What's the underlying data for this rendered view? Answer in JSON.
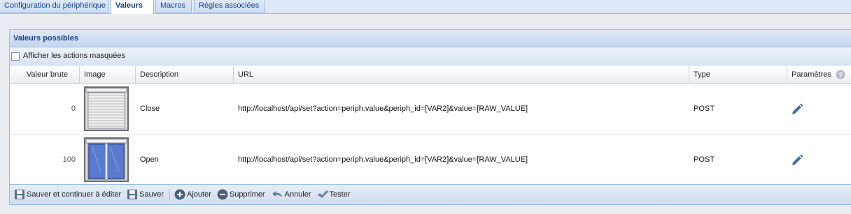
{
  "tabs": [
    {
      "label": "Configuration du périphérique"
    },
    {
      "label": "Valeurs"
    },
    {
      "label": "Macros"
    },
    {
      "label": "Règles associées"
    }
  ],
  "panel": {
    "title": "Valeurs possibles",
    "show_hidden_label": "Afficher les actions masquées"
  },
  "columns": {
    "raw": "Valeur brute",
    "image": "Image",
    "description": "Description",
    "url": "URL",
    "type": "Type",
    "params": "Paramètres"
  },
  "rows": [
    {
      "raw": "0",
      "image": "shutter-closed-icon",
      "description": "Close",
      "url": "http://localhost/api/set?action=periph.value&periph_id=[VAR2]&value=[RAW_VALUE]",
      "type": "POST"
    },
    {
      "raw": "100",
      "image": "shutter-open-icon",
      "description": "Open",
      "url": "http://localhost/api/set?action=periph.value&periph_id=[VAR2]&value=[RAW_VALUE]",
      "type": "POST"
    }
  ],
  "footer": {
    "save_continue": "Sauver et continuer à éditer",
    "save": "Sauver",
    "add": "Ajouter",
    "delete": "Supprimer",
    "cancel": "Annuler",
    "test": "Tester"
  },
  "colors": {
    "accent": "#15428b",
    "border": "#99bbe8",
    "edit_icon": "#4a6fa5"
  }
}
